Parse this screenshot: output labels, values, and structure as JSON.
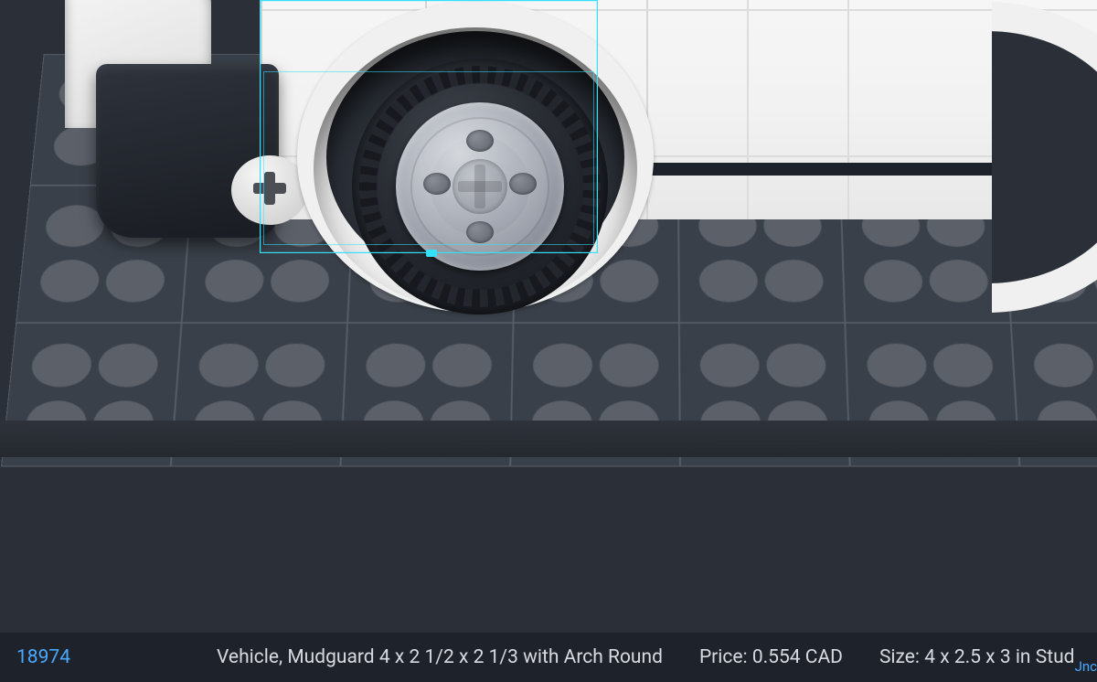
{
  "statusbar": {
    "part_id": "18974",
    "part_name": "Vehicle, Mudguard 4 x 2 1/2 x 2 1/3 with Arch Round",
    "price_label": "Price: 0.554 CAD",
    "size_label": "Size: 4 x 2.5 x 3 in Stud",
    "link_truncated": "Jnc"
  },
  "selection": {
    "color": "#33e1ff"
  }
}
